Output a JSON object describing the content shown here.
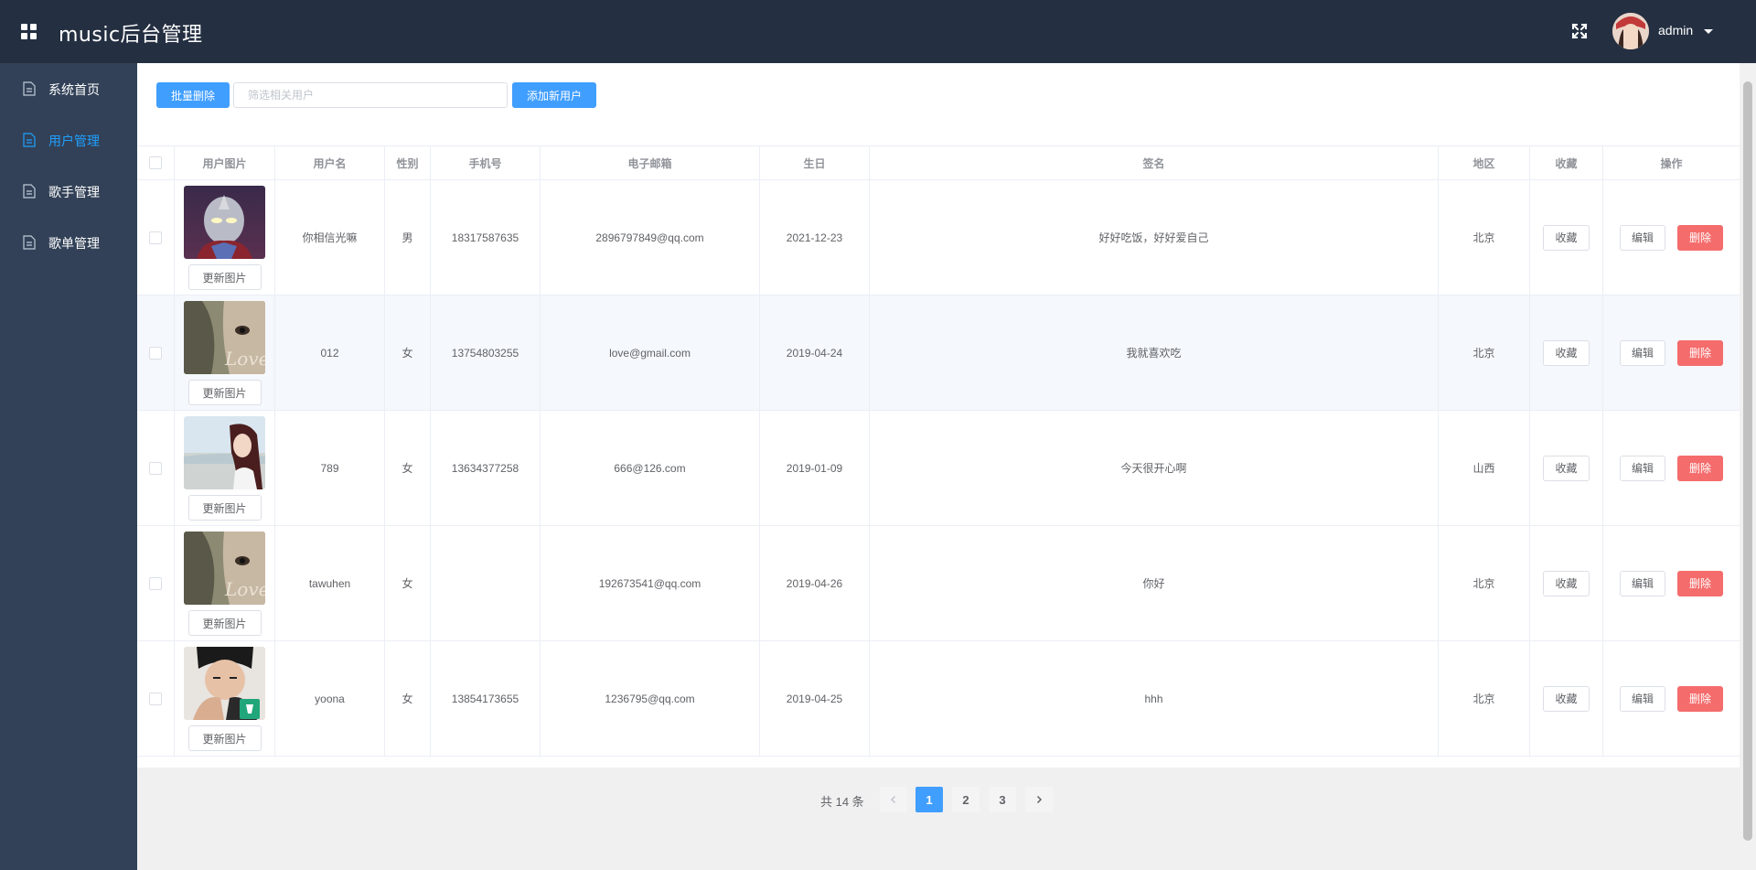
{
  "header": {
    "title": "music后台管理",
    "username": "admin"
  },
  "sidebar": {
    "items": [
      {
        "label": "系统首页",
        "active": false
      },
      {
        "label": "用户管理",
        "active": true
      },
      {
        "label": "歌手管理",
        "active": false
      },
      {
        "label": "歌单管理",
        "active": false
      }
    ]
  },
  "toolbar": {
    "batch_delete": "批量删除",
    "search_placeholder": "筛选相关用户",
    "search_value": "",
    "add_user": "添加新用户"
  },
  "table": {
    "columns": [
      "",
      "用户图片",
      "用户名",
      "性别",
      "手机号",
      "电子邮箱",
      "生日",
      "签名",
      "地区",
      "收藏",
      "操作"
    ],
    "update_photo_label": "更新图片",
    "collect_label": "收藏",
    "edit_label": "编辑",
    "delete_label": "删除",
    "rows": [
      {
        "username": "你相信光嘛",
        "gender": "男",
        "phone": "18317587635",
        "email": "2896797849@qq.com",
        "birthday": "2021-12-23",
        "signature": "好好吃饭，好好爱自己",
        "region": "北京"
      },
      {
        "username": "012",
        "gender": "女",
        "phone": "13754803255",
        "email": "love@gmail.com",
        "birthday": "2019-04-24",
        "signature": "我就喜欢吃",
        "region": "北京"
      },
      {
        "username": "789",
        "gender": "女",
        "phone": "13634377258",
        "email": "666@126.com",
        "birthday": "2019-01-09",
        "signature": "今天很开心啊",
        "region": "山西"
      },
      {
        "username": "tawuhen",
        "gender": "女",
        "phone": "",
        "email": "192673541@qq.com",
        "birthday": "2019-04-26",
        "signature": "你好",
        "region": "北京"
      },
      {
        "username": "yoona",
        "gender": "女",
        "phone": "13854173655",
        "email": "1236795@qq.com",
        "birthday": "2019-04-25",
        "signature": "hhh",
        "region": "北京"
      }
    ]
  },
  "pagination": {
    "total_text": "共 14 条",
    "pages": [
      "1",
      "2",
      "3"
    ],
    "current": "1"
  },
  "colors": {
    "header_bg": "#242f42",
    "sidebar_bg": "#324157",
    "accent": "#409eff",
    "danger": "#f56c6c"
  }
}
